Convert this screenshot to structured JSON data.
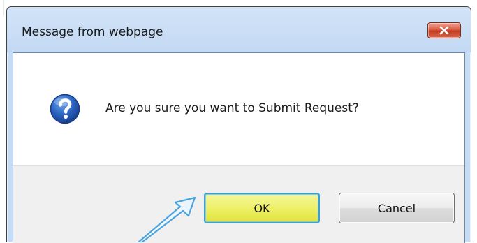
{
  "dialog": {
    "title": "Message from webpage",
    "message": "Are you sure you want to Submit Request?",
    "icon": "question-icon",
    "close_icon": "close-icon"
  },
  "buttons": {
    "ok_label": "OK",
    "cancel_label": "Cancel"
  },
  "colors": {
    "titlebar": "#c5dcf4",
    "close_button": "#d8563d",
    "ok_button_highlight": "#eef069",
    "ok_button_border": "#3c9fd0",
    "arrow": "#4aa3dd"
  }
}
